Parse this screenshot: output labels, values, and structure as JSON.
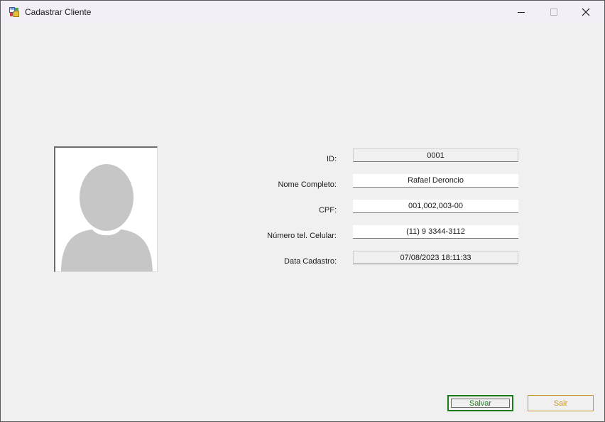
{
  "window": {
    "title": "Cadastrar Cliente",
    "icon": "form-app-icon",
    "controls": {
      "minimize_icon": "minimize-icon",
      "maximize_icon": "maximize-icon",
      "close_icon": "close-icon"
    }
  },
  "photo": {
    "icon": "user-silhouette-icon"
  },
  "form": {
    "id_label": "ID:",
    "id_value": "0001",
    "name_label": "Nome Completo:",
    "name_value": "Rafael Deroncio",
    "cpf_label": "CPF:",
    "cpf_value": "001,002,003-00",
    "phone_label": "Número tel. Celular:",
    "phone_value": "(11) 9 3344-3112",
    "date_label": "Data Cadastro:",
    "date_value": "07/08/2023 18:11:33"
  },
  "buttons": {
    "save_label": "Salvar",
    "exit_label": "Sair"
  },
  "colors": {
    "save_accent": "#1d7a1d",
    "exit_accent": "#c8962a",
    "window_bg": "#f0f0f0",
    "titlebar_bg": "#f3eff6"
  }
}
